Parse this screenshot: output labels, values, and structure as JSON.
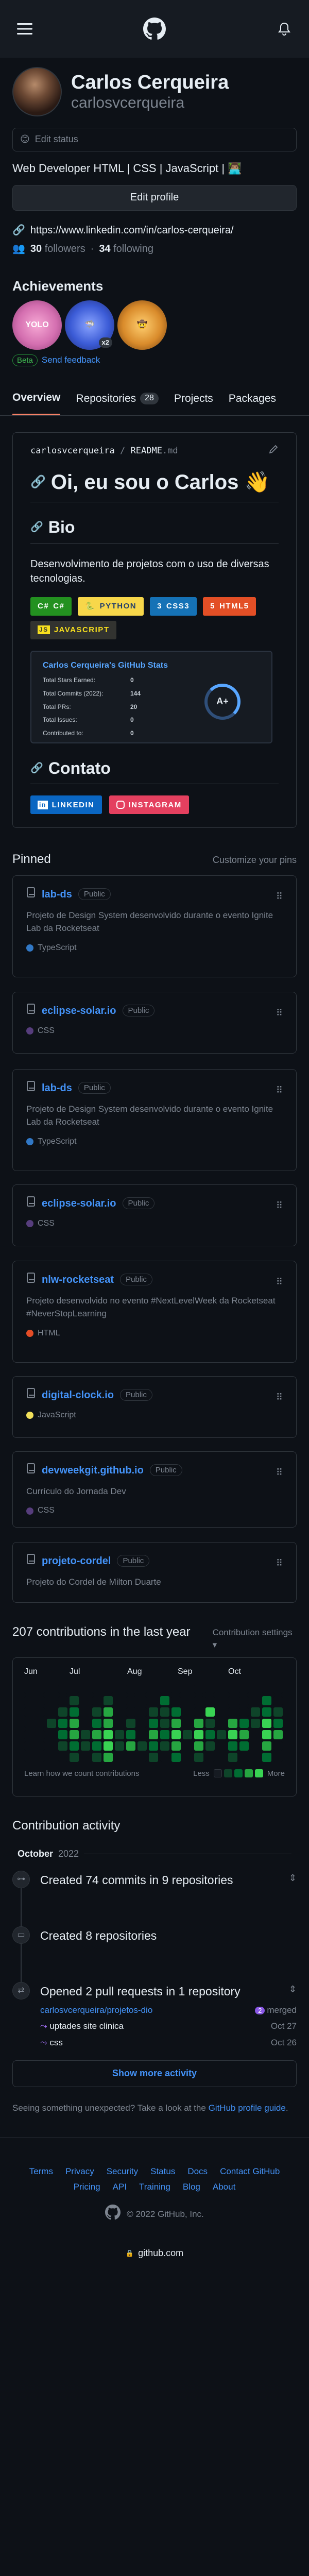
{
  "header": {
    "menu_icon": "hamburger-icon",
    "logo_icon": "github-logo-icon",
    "bell_icon": "bell-icon"
  },
  "profile": {
    "fullname": "Carlos Cerqueira",
    "login": "carlosvcerqueira",
    "status_placeholder": "Edit status",
    "bio": "Web Developer HTML | CSS | JavaScript | 👨🏽‍💻",
    "edit_label": "Edit profile",
    "link": "https://www.linkedin.com/in/carlos-cerqueira/",
    "followers_count": "30",
    "followers_label": "followers",
    "following_count": "34",
    "following_label": "following"
  },
  "achievements": {
    "title": "Achievements",
    "badges": [
      {
        "name": "YOLO",
        "color": "#d46fb0"
      },
      {
        "name": "Pull Shark",
        "color": "#3b5bd6",
        "multiplier": "x2"
      },
      {
        "name": "Quickdraw",
        "color": "#d98b2b"
      }
    ],
    "beta_label": "Beta",
    "feedback_label": "Send feedback"
  },
  "tabs": [
    {
      "label": "Overview"
    },
    {
      "label": "Repositories",
      "count": "28"
    },
    {
      "label": "Projects"
    },
    {
      "label": "Packages"
    }
  ],
  "readme": {
    "path_user": "carlosvcerqueira",
    "path_sep": "/",
    "path_file": "README",
    "path_ext": ".md",
    "heading": "Oi, eu sou o Carlos 👋",
    "bio_heading": "Bio",
    "bio_text": "Desenvolvimento de projetos com o uso de diversas tecnologias.",
    "shields": [
      {
        "label": "C#",
        "bg": "#239120",
        "fg": "#ffffff",
        "icon": "C#"
      },
      {
        "label": "PYTHON",
        "bg": "#f7d74a",
        "fg": "#1f3d6b",
        "icon": "🐍"
      },
      {
        "label": "CSS3",
        "bg": "#1572b6",
        "fg": "#ffffff",
        "icon": "3"
      },
      {
        "label": "HTML5",
        "bg": "#e34f26",
        "fg": "#ffffff",
        "icon": "5"
      },
      {
        "label": "JAVASCRIPT",
        "bg": "#323330",
        "fg": "#f7df1e",
        "icon": "JS"
      }
    ],
    "stats": {
      "title": "Carlos Cerqueira's GitHub Stats",
      "rows": [
        {
          "label": "Total Stars Earned:",
          "value": "0"
        },
        {
          "label": "Total Commits (2022):",
          "value": "144"
        },
        {
          "label": "Total PRs:",
          "value": "20"
        },
        {
          "label": "Total Issues:",
          "value": "0"
        },
        {
          "label": "Contributed to:",
          "value": "0"
        }
      ],
      "grade": "A+"
    },
    "contact_heading": "Contato",
    "social": [
      {
        "label": "LINKEDIN",
        "bg": "#0a66c2"
      },
      {
        "label": "INSTAGRAM",
        "bg": "#e4405f"
      }
    ]
  },
  "pinned": {
    "title": "Pinned",
    "customize": "Customize your pins",
    "public_label": "Public",
    "items": [
      {
        "name": "lab-ds",
        "desc": "Projeto de Design System desenvolvido durante o evento Ignite Lab da Rocketseat",
        "lang": "TypeScript",
        "color": "#3178c6"
      },
      {
        "name": "eclipse-solar.io",
        "desc": "",
        "lang": "CSS",
        "color": "#563d7c"
      },
      {
        "name": "lab-ds",
        "desc": "Projeto de Design System desenvolvido durante o evento Ignite Lab da Rocketseat",
        "lang": "TypeScript",
        "color": "#3178c6"
      },
      {
        "name": "eclipse-solar.io",
        "desc": "",
        "lang": "CSS",
        "color": "#563d7c"
      },
      {
        "name": "nlw-rocketseat",
        "desc": "Projeto desenvolvido no evento #NextLevelWeek da Rocketseat #NeverStopLearning",
        "lang": "HTML",
        "color": "#e34c26"
      },
      {
        "name": "digital-clock.io",
        "desc": "",
        "lang": "JavaScript",
        "color": "#f1e05a"
      },
      {
        "name": "devweekgit.github.io",
        "desc": "Currículo do Jornada Dev",
        "lang": "CSS",
        "color": "#563d7c"
      },
      {
        "name": "projeto-cordel",
        "desc": "Projeto do Cordel de Milton Duarte",
        "lang": "",
        "color": ""
      }
    ]
  },
  "contributions": {
    "title": "207 contributions in the last year",
    "settings": "Contribution settings ▾",
    "months": [
      "Jun",
      "Jul",
      "Aug",
      "Sep",
      "Oct"
    ],
    "learn": "Learn how we count contributions",
    "less": "Less",
    "more": "More",
    "levels": [
      "#161b22",
      "#0e4429",
      "#006d32",
      "#26a641",
      "#39d353"
    ]
  },
  "activity": {
    "title": "Contribution activity",
    "month": "October",
    "year": "2022",
    "items": [
      {
        "text": "Created 74 commits in 9 repositories"
      },
      {
        "text": "Created 8 repositories"
      },
      {
        "text": "Opened 2 pull requests in 1 repository"
      }
    ],
    "pr_repo": "carlosvcerqueira/projetos-dio",
    "pr_merged_count": "2",
    "pr_merged_label": "merged",
    "prs": [
      {
        "title": "uptades site clinica",
        "date": "Oct 27"
      },
      {
        "title": "css",
        "date": "Oct 26"
      }
    ],
    "show_more": "Show more activity",
    "unexpected_pre": "Seeing something unexpected? Take a look at the",
    "unexpected_link": "GitHub profile guide",
    "unexpected_post": "."
  },
  "footer": {
    "links": [
      "Terms",
      "Privacy",
      "Security",
      "Status",
      "Docs",
      "Contact GitHub",
      "Pricing",
      "API",
      "Training",
      "Blog",
      "About"
    ],
    "copyright": "© 2022 GitHub, Inc."
  },
  "browser": {
    "url": "github.com"
  }
}
